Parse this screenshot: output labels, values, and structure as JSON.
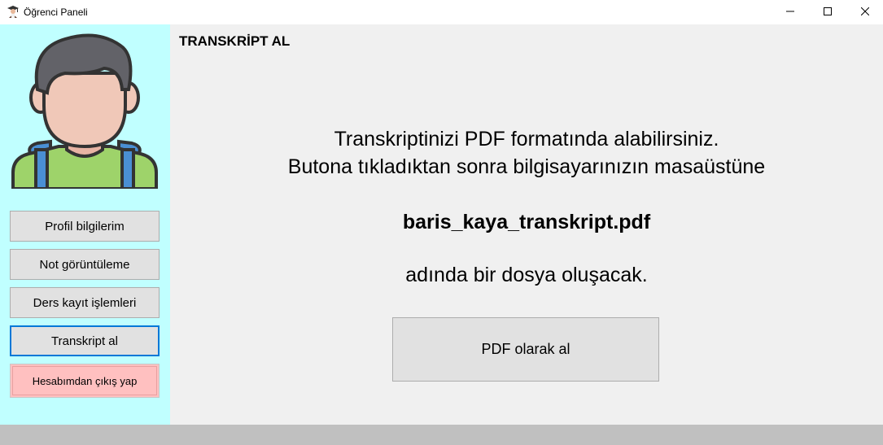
{
  "window": {
    "title": "Öğrenci Paneli",
    "app_icon": "graduate-icon",
    "controls": {
      "minimize_icon": "minimize-icon",
      "maximize_icon": "maximize-icon",
      "close_icon": "close-icon"
    }
  },
  "sidebar": {
    "background": "#c0ffff",
    "avatar_icon": "student-avatar-icon",
    "items": [
      {
        "label": "Profil bilgilerim"
      },
      {
        "label": "Not görüntüleme"
      },
      {
        "label": "Ders kayıt işlemleri"
      },
      {
        "label": "Transkript al",
        "active": true
      },
      {
        "label": "Hesabımdan çıkış yap",
        "style": "logout"
      }
    ]
  },
  "main": {
    "title": "TRANSKRİPT AL",
    "line1": "Transkriptinizi PDF formatında alabilirsiniz.",
    "line2": "Butona tıkladıktan sonra bilgisayarınızın masaüstüne",
    "filename": "baris_kaya_transkript.pdf",
    "line3": "adında bir dosya oluşacak.",
    "pdf_button_label": "PDF olarak al"
  },
  "colors": {
    "accent": "#0078d7",
    "logout": "#ffc0c0",
    "main_bg": "#f0f0f0",
    "status_bar": "#c0c0c0"
  }
}
